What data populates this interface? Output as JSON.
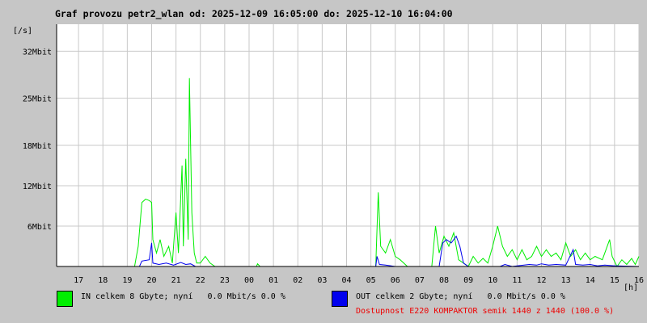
{
  "title": "Graf provozu petr2_wlan od: 2025-12-09 16:05:00 do: 2025-12-10 16:04:00",
  "colors": {
    "background": "#c6c6c6",
    "plot_bg": "#ffffff",
    "grid": "#c8c8c8",
    "in": "#00ee00",
    "out": "#0000ee",
    "availability": "#ee0000"
  },
  "legend": {
    "in": {
      "text": "IN celkem 8 Gbyte; nyní   0.0 Mbit/s 0.0 %",
      "color": "#00ee00"
    },
    "out": {
      "text": "OUT celkem 2 Gbyte; nyní   0.0 Mbit/s 0.0 %",
      "color": "#0000ee"
    },
    "availability": "Dostupnost E220 KOMPAKTOR semik 1440 z 1440 (100.0 %)"
  },
  "chart_data": {
    "type": "line",
    "title": "Graf provozu petr2_wlan od: 2025-12-09 16:05:00 do: 2025-12-10 16:04:00",
    "ylabel": "[/s]",
    "xlabel": "[h]",
    "y_unit": "Mbit",
    "ylim": [
      0,
      36
    ],
    "y_ticks": [
      6,
      12,
      18,
      25,
      32
    ],
    "y_tick_labels": [
      "6Mbit",
      "12Mbit",
      "18Mbit",
      "25Mbit",
      "32Mbit"
    ],
    "x_ticks": [
      "17",
      "18",
      "19",
      "20",
      "21",
      "22",
      "23",
      "00",
      "01",
      "02",
      "03",
      "04",
      "05",
      "06",
      "07",
      "08",
      "09",
      "10",
      "11",
      "12",
      "13",
      "14",
      "15",
      "16"
    ],
    "grid": true,
    "series": [
      {
        "name": "IN",
        "color": "#00ee00",
        "points": [
          [
            16.1,
            0
          ],
          [
            19.3,
            0
          ],
          [
            19.45,
            3
          ],
          [
            19.6,
            9.5
          ],
          [
            19.75,
            10
          ],
          [
            19.9,
            9.8
          ],
          [
            20.0,
            9.5
          ],
          [
            20.05,
            4
          ],
          [
            20.2,
            2
          ],
          [
            20.35,
            4
          ],
          [
            20.5,
            1.5
          ],
          [
            20.7,
            3
          ],
          [
            20.85,
            0.5
          ],
          [
            21.0,
            8
          ],
          [
            21.1,
            2
          ],
          [
            21.25,
            15
          ],
          [
            21.3,
            3
          ],
          [
            21.4,
            16
          ],
          [
            21.5,
            4
          ],
          [
            21.55,
            28
          ],
          [
            21.65,
            8
          ],
          [
            21.75,
            2
          ],
          [
            21.85,
            0.5
          ],
          [
            22.0,
            0.5
          ],
          [
            22.2,
            1.5
          ],
          [
            22.4,
            0.5
          ],
          [
            22.6,
            0
          ],
          [
            24.3,
            0
          ],
          [
            24.35,
            0.4
          ],
          [
            24.45,
            0
          ],
          [
            29.2,
            0
          ],
          [
            29.3,
            11
          ],
          [
            29.4,
            3
          ],
          [
            29.6,
            2
          ],
          [
            29.8,
            4
          ],
          [
            30.0,
            1.5
          ],
          [
            30.2,
            1
          ],
          [
            30.5,
            0
          ],
          [
            31.5,
            0
          ],
          [
            31.65,
            6
          ],
          [
            31.8,
            2
          ],
          [
            32.0,
            4.5
          ],
          [
            32.2,
            3
          ],
          [
            32.4,
            5
          ],
          [
            32.6,
            1
          ],
          [
            32.8,
            0.5
          ],
          [
            33.0,
            0
          ],
          [
            33.2,
            1.5
          ],
          [
            33.4,
            0.5
          ],
          [
            33.6,
            1.2
          ],
          [
            33.8,
            0.5
          ],
          [
            34.0,
            3
          ],
          [
            34.2,
            6
          ],
          [
            34.4,
            3
          ],
          [
            34.6,
            1.5
          ],
          [
            34.8,
            2.5
          ],
          [
            35.0,
            1
          ],
          [
            35.2,
            2.5
          ],
          [
            35.4,
            1
          ],
          [
            35.6,
            1.5
          ],
          [
            35.8,
            3
          ],
          [
            36.0,
            1.5
          ],
          [
            36.2,
            2.5
          ],
          [
            36.4,
            1.5
          ],
          [
            36.6,
            2
          ],
          [
            36.8,
            1
          ],
          [
            37.0,
            3.5
          ],
          [
            37.2,
            1.5
          ],
          [
            37.4,
            2.5
          ],
          [
            37.6,
            1
          ],
          [
            37.8,
            2
          ],
          [
            38.0,
            1
          ],
          [
            38.2,
            1.5
          ],
          [
            38.5,
            1
          ],
          [
            38.8,
            4
          ],
          [
            38.9,
            1.5
          ],
          [
            39.1,
            0
          ],
          [
            39.3,
            1
          ],
          [
            39.5,
            0.3
          ],
          [
            39.7,
            1.2
          ],
          [
            39.85,
            0.3
          ],
          [
            40.0,
            1.5
          ]
        ]
      },
      {
        "name": "OUT",
        "color": "#0000ee",
        "points": [
          [
            16.1,
            0
          ],
          [
            19.5,
            0
          ],
          [
            19.6,
            0.8
          ],
          [
            19.9,
            1
          ],
          [
            20.0,
            3.5
          ],
          [
            20.05,
            0.5
          ],
          [
            20.3,
            0.3
          ],
          [
            20.6,
            0.5
          ],
          [
            20.9,
            0.2
          ],
          [
            21.2,
            0.6
          ],
          [
            21.4,
            0.3
          ],
          [
            21.6,
            0.4
          ],
          [
            21.8,
            0
          ],
          [
            29.2,
            0
          ],
          [
            29.25,
            1.5
          ],
          [
            29.35,
            0.3
          ],
          [
            29.6,
            0.2
          ],
          [
            30.0,
            0
          ],
          [
            31.8,
            0
          ],
          [
            31.95,
            3.5
          ],
          [
            32.1,
            4
          ],
          [
            32.3,
            3.5
          ],
          [
            32.5,
            4.5
          ],
          [
            32.65,
            3
          ],
          [
            32.8,
            0.5
          ],
          [
            33.0,
            0
          ],
          [
            34.3,
            0
          ],
          [
            34.5,
            0.3
          ],
          [
            34.8,
            0
          ],
          [
            35.5,
            0.3
          ],
          [
            35.8,
            0.2
          ],
          [
            36.0,
            0.4
          ],
          [
            36.3,
            0.2
          ],
          [
            36.6,
            0.3
          ],
          [
            37.0,
            0.2
          ],
          [
            37.3,
            2.5
          ],
          [
            37.4,
            0.3
          ],
          [
            37.7,
            0.2
          ],
          [
            38.0,
            0.3
          ],
          [
            38.3,
            0.1
          ],
          [
            38.6,
            0.2
          ],
          [
            39.0,
            0.1
          ],
          [
            40.0,
            0
          ]
        ]
      }
    ]
  }
}
